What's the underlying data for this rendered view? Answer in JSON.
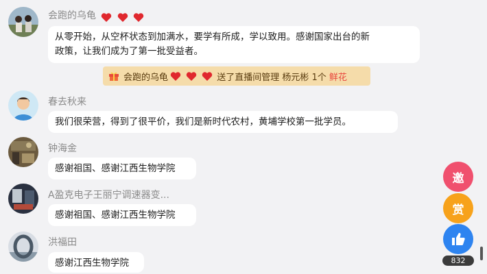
{
  "messages": [
    {
      "name": "会跑的乌龟",
      "hearts": 3,
      "text_line1": "从零开始，从空杯状态到加满水，要学有所成，学以致用。感谢国家出台的新",
      "text_line2": "政策，让我们成为了第一批受益者。"
    },
    {
      "name": "春去秋来",
      "text": "我们很荣营，得到了很平价，我们是新时代农村，黄埔学校第一批学员。"
    },
    {
      "name": "钟海金",
      "text": "感谢祖国、感谢江西生物学院"
    },
    {
      "name": "A盈克电子王丽宁调速器变...",
      "text": "感谢祖国、感谢江西生物学院"
    },
    {
      "name": "洪福田",
      "text": "感谢江西生物学院"
    }
  ],
  "gift": {
    "sender": "会跑的乌龟",
    "hearts": 3,
    "action": "送了直播间管理 杨元彬 1个",
    "item": "鲜花"
  },
  "side": {
    "invite_label": "邀",
    "reward_label": "赏",
    "like_count": "832"
  },
  "colors": {
    "invite": "#f0506e",
    "reward": "#f7a21b",
    "like": "#2e84f0",
    "heart": "#e0282e"
  }
}
